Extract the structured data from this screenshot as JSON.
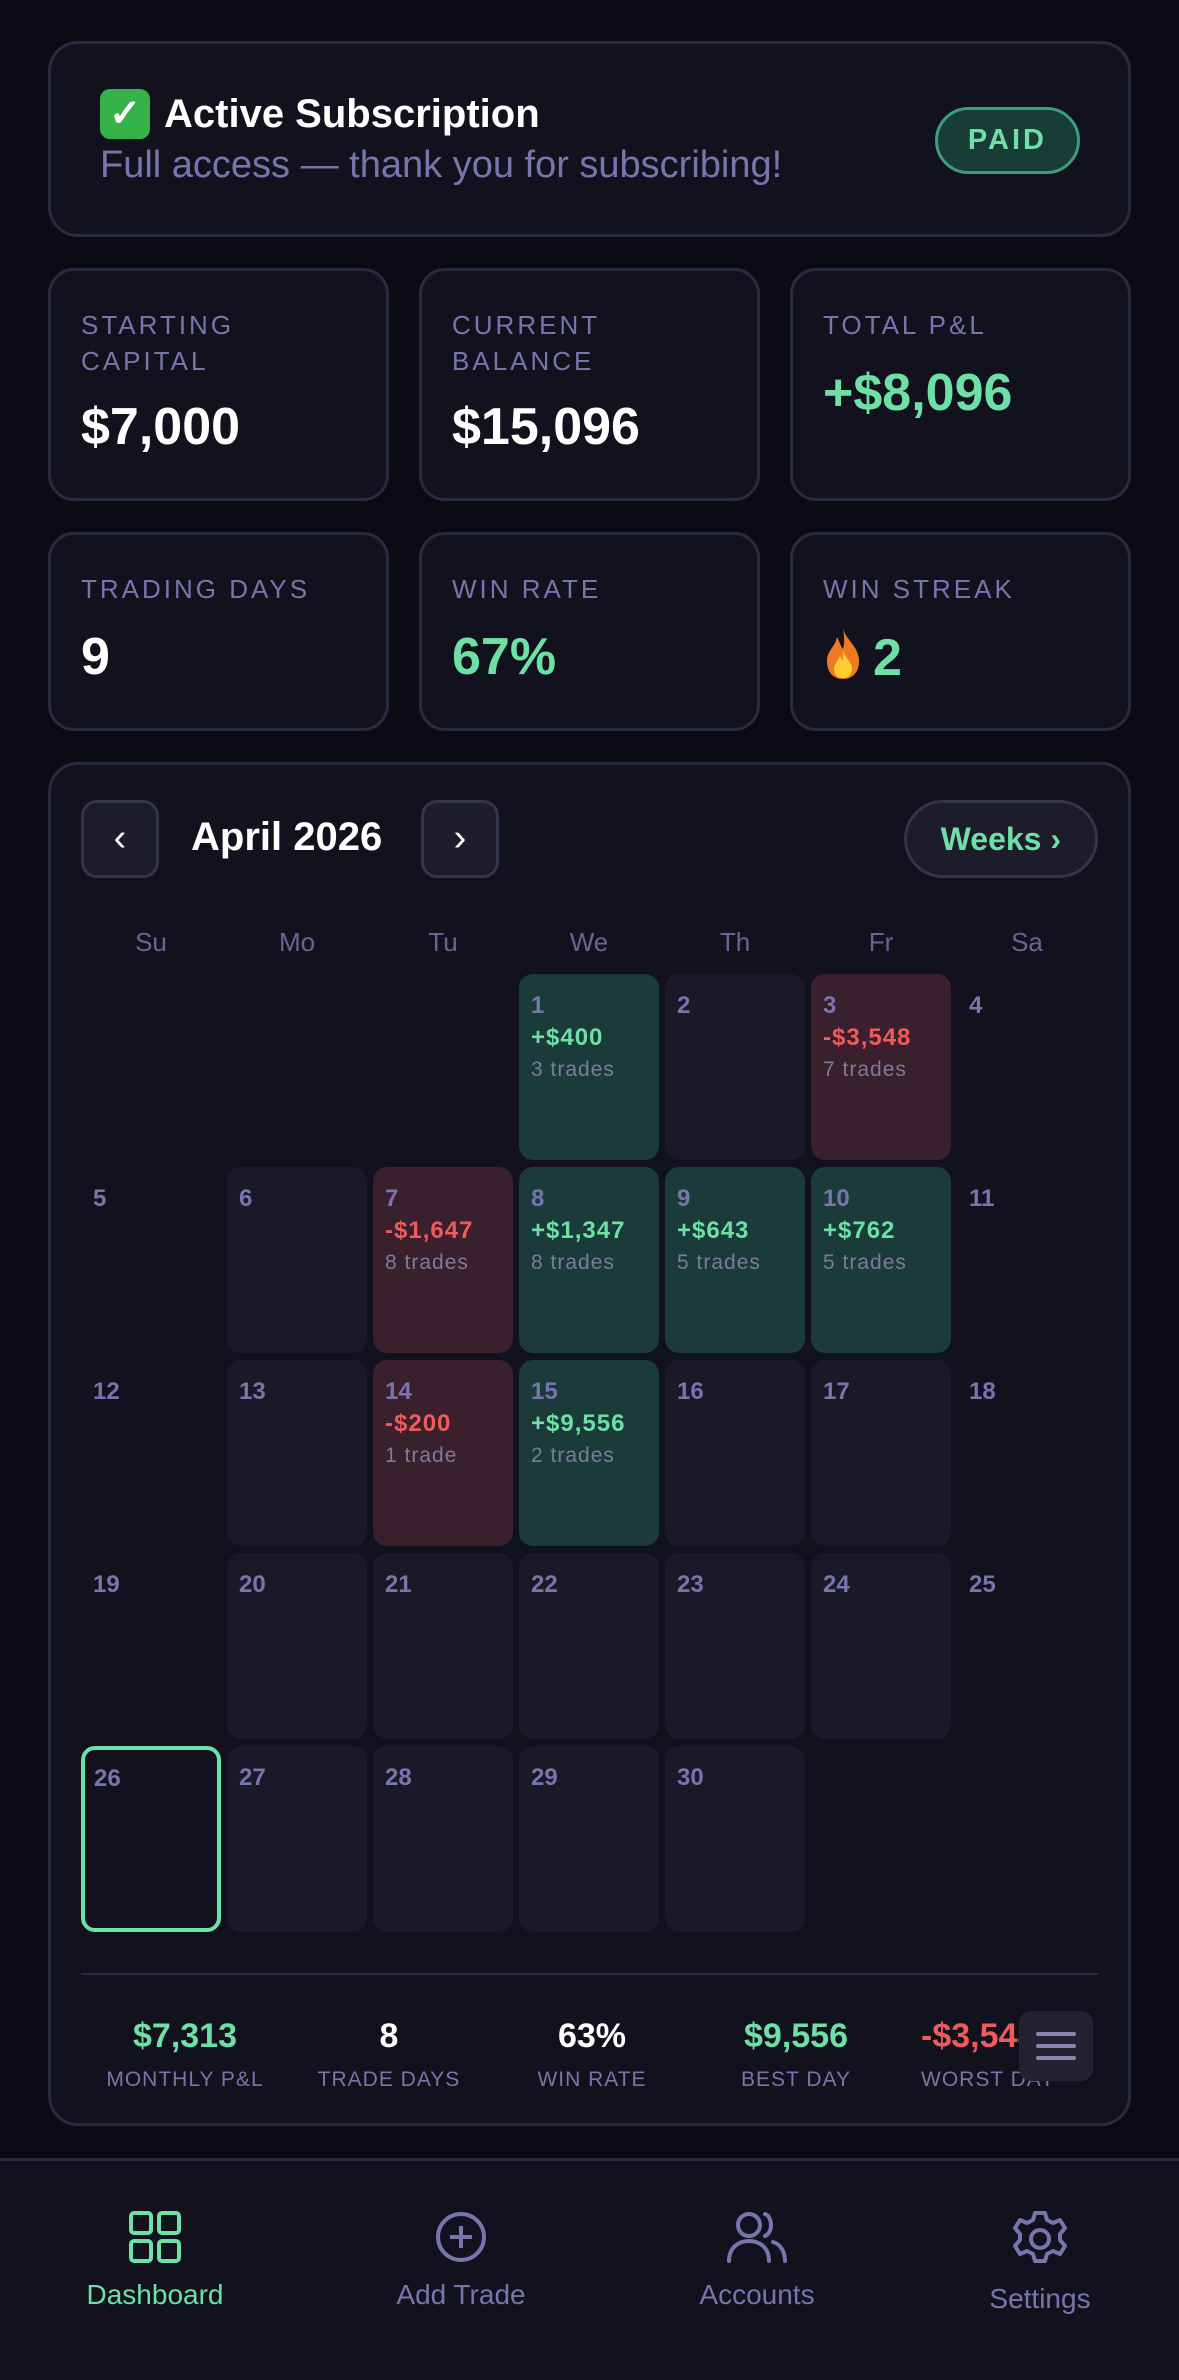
{
  "subscription": {
    "title": "Active Subscription",
    "subtitle": "Full access — thank you for subscribing!",
    "badge": "PAID"
  },
  "stats": {
    "starting_capital": {
      "label": "Starting Capital",
      "value": "$7,000"
    },
    "current_balance": {
      "label": "Current Balance",
      "value": "$15,096"
    },
    "total_pnl": {
      "label": "Total P&L",
      "value": "+$8,096"
    },
    "trading_days": {
      "label": "Trading Days",
      "value": "9"
    },
    "win_rate": {
      "label": "Win Rate",
      "value": "67%"
    },
    "win_streak": {
      "label": "Win Streak",
      "value": "2"
    }
  },
  "calendar": {
    "prev": "‹",
    "next": "›",
    "month": "April 2026",
    "weeks_button": "Weeks ›",
    "weekdays": [
      "Su",
      "Mo",
      "Tu",
      "We",
      "Th",
      "Fr",
      "Sa"
    ],
    "days": {
      "1": {
        "num": "1",
        "pnl": "+$400",
        "trades": "3 trades"
      },
      "2": {
        "num": "2"
      },
      "3": {
        "num": "3",
        "pnl": "-$3,548",
        "trades": "7 trades"
      },
      "4": {
        "num": "4"
      },
      "5": {
        "num": "5"
      },
      "6": {
        "num": "6"
      },
      "7": {
        "num": "7",
        "pnl": "-$1,647",
        "trades": "8 trades"
      },
      "8": {
        "num": "8",
        "pnl": "+$1,347",
        "trades": "8 trades"
      },
      "9": {
        "num": "9",
        "pnl": "+$643",
        "trades": "5 trades"
      },
      "10": {
        "num": "10",
        "pnl": "+$762",
        "trades": "5 trades"
      },
      "11": {
        "num": "11"
      },
      "12": {
        "num": "12"
      },
      "13": {
        "num": "13"
      },
      "14": {
        "num": "14",
        "pnl": "-$200",
        "trades": "1 trade"
      },
      "15": {
        "num": "15",
        "pnl": "+$9,556",
        "trades": "2 trades"
      },
      "16": {
        "num": "16"
      },
      "17": {
        "num": "17"
      },
      "18": {
        "num": "18"
      },
      "19": {
        "num": "19"
      },
      "20": {
        "num": "20"
      },
      "21": {
        "num": "21"
      },
      "22": {
        "num": "22"
      },
      "23": {
        "num": "23"
      },
      "24": {
        "num": "24"
      },
      "25": {
        "num": "25"
      },
      "26": {
        "num": "26"
      },
      "27": {
        "num": "27"
      },
      "28": {
        "num": "28"
      },
      "29": {
        "num": "29"
      },
      "30": {
        "num": "30"
      }
    },
    "summary": {
      "monthly_pnl": {
        "value": "$7,313",
        "label": "MONTHLY P&L"
      },
      "trade_days": {
        "value": "8",
        "label": "TRADE DAYS"
      },
      "win_rate": {
        "value": "63%",
        "label": "WIN RATE"
      },
      "best_day": {
        "value": "$9,556",
        "label": "BEST DAY"
      },
      "worst_day": {
        "value": "-$3,548",
        "label": "WORST DAY"
      }
    }
  },
  "tabs": {
    "dashboard": "Dashboard",
    "add_trade": "Add Trade",
    "accounts": "Accounts",
    "settings": "Settings"
  },
  "colors": {
    "accent_green": "#6ee0a6",
    "loss_red": "#ef5b5b",
    "background": "#0b0b14"
  }
}
